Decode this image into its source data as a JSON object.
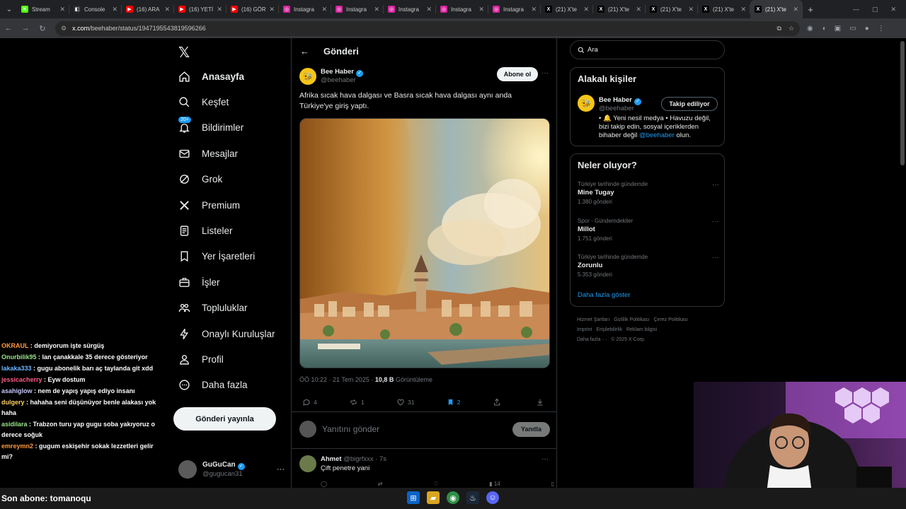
{
  "browser": {
    "tabs": [
      {
        "title": "Stream",
        "favicon": "k-icon",
        "color": "#53fc18"
      },
      {
        "title": "Console",
        "favicon": "kick-icon",
        "color": "#2d2d2d"
      },
      {
        "title": "(16) ARA",
        "favicon": "youtube-icon",
        "color": "#ff0000"
      },
      {
        "title": "(16) YETİ",
        "favicon": "youtube-icon",
        "color": "#ff0000"
      },
      {
        "title": "(16) GÖR",
        "favicon": "youtube-icon",
        "color": "#ff0000"
      },
      {
        "title": "Instagra",
        "favicon": "instagram-icon",
        "color": "#d6249f"
      },
      {
        "title": "Instagra",
        "favicon": "instagram-icon",
        "color": "#d6249f"
      },
      {
        "title": "Instagra",
        "favicon": "instagram-icon",
        "color": "#d6249f"
      },
      {
        "title": "Instagra",
        "favicon": "instagram-icon",
        "color": "#d6249f"
      },
      {
        "title": "Instagra",
        "favicon": "instagram-icon",
        "color": "#d6249f"
      },
      {
        "title": "(21) X'te",
        "favicon": "x-icon",
        "color": "#000000"
      },
      {
        "title": "(21) X'te",
        "favicon": "x-icon",
        "color": "#000000"
      },
      {
        "title": "(21) X'te",
        "favicon": "x-icon",
        "color": "#000000"
      },
      {
        "title": "(21) X'te",
        "favicon": "x-icon",
        "color": "#000000"
      },
      {
        "title": "(21) X'te",
        "favicon": "x-icon",
        "color": "#000000",
        "active": true
      }
    ],
    "url_site": "x.com",
    "url_path": "/beehaber/status/1947195543819596266"
  },
  "nav": {
    "items": [
      {
        "label": "Anasayfa",
        "icon": "home-icon"
      },
      {
        "label": "Keşfet",
        "icon": "search-icon"
      },
      {
        "label": "Bildirimler",
        "icon": "bell-icon",
        "badge": "20+"
      },
      {
        "label": "Mesajlar",
        "icon": "mail-icon"
      },
      {
        "label": "Grok",
        "icon": "grok-icon"
      },
      {
        "label": "Premium",
        "icon": "x-logo-icon"
      },
      {
        "label": "Listeler",
        "icon": "list-icon"
      },
      {
        "label": "Yer İşaretleri",
        "icon": "bookmark-icon"
      },
      {
        "label": "İşler",
        "icon": "briefcase-icon"
      },
      {
        "label": "Topluluklar",
        "icon": "people-icon"
      },
      {
        "label": "Onaylı Kuruluşlar",
        "icon": "lightning-icon"
      },
      {
        "label": "Profil",
        "icon": "person-icon"
      },
      {
        "label": "Daha fazla",
        "icon": "more-circle-icon"
      }
    ],
    "post_button": "Gönderi yayınla",
    "account": {
      "name": "GuGuCan",
      "handle": "@gugucan31"
    }
  },
  "main": {
    "header_title": "Gönderi",
    "post": {
      "author": "Bee Haber",
      "handle": "@beehaber",
      "subscribe_label": "Abone ol",
      "text": "Afrika sıcak hava dalgası ve Basra sıcak hava dalgası aynı anda Türkiye'ye giriş yaptı.",
      "time": "ÖÖ 10:22 · 21 Tem 2025 · ",
      "views": "10,8 B",
      "views_label": " Görüntüleme",
      "actions": {
        "replies": "4",
        "reposts": "1",
        "likes": "31",
        "bookmarks": "2"
      }
    },
    "reply": {
      "placeholder": "Yanıtını gönder",
      "button": "Yanıtla"
    },
    "comment": {
      "name": "Ahmet",
      "meta": "@bigrfxxx · 7s",
      "text": "Çift penetre yani",
      "views": "14"
    }
  },
  "side": {
    "search_placeholder": "Ara",
    "related_title": "Alakalı kişiler",
    "related": {
      "name": "Bee Haber",
      "handle": "@beehaber",
      "button": "Takip ediliyor",
      "bio_pre": "• 🔔 Yeni nesil medya • Havuzu değil, bizi takip edin, sosyal içeriklerden bihaber değil ",
      "bio_link": "@beehaber",
      "bio_post": " olun."
    },
    "trends_title": "Neler oluyor?",
    "trends": [
      {
        "context": "Türkiye tarihinde gündemde",
        "name": "Mine Tugay",
        "posts": "1.380 gönderi"
      },
      {
        "context": "Spor · Gündemdekiler",
        "name": "Millot",
        "posts": "1.751 gönderi"
      },
      {
        "context": "Türkiye tarihinde gündemde",
        "name": "Zorunlu",
        "posts": "5.353 gönderi"
      }
    ],
    "show_more": "Daha fazla göster",
    "footer": [
      "Hizmet Şartları",
      "Gizlilik Politikası",
      "Çerez Politikası",
      "Imprint",
      "Erişilebilirlik",
      "Reklam bilgisi",
      "Daha fazla ···",
      "© 2025 X Corp."
    ]
  },
  "chat": [
    {
      "user": "OKRAUL",
      "msg": "demiyorum işte sürgüş"
    },
    {
      "user": "Onurbilik95",
      "msg": "lan çanakkale 35 derece gösteriyor"
    },
    {
      "user": "lakaka333",
      "msg": "gugu abonelik barı aç taylanda git xdd"
    },
    {
      "user": "jessicacherry",
      "msg": "Eyw dostum"
    },
    {
      "user": "asahiglow",
      "msg": "nem de yapış yapış ediyo insanı"
    },
    {
      "user": "dulgery",
      "msg": "hahaha seni düşünüyor benle alakası yok haha"
    },
    {
      "user": "asidilara",
      "msg": "Trabzon turu yap gugu soba yakıyoruz o derece soğuk"
    },
    {
      "user": "emreymn2",
      "msg": "gugum eskişehir sokak lezzetleri gelir mi?"
    }
  ],
  "subscriber_banner": "Son abone: tomanoqu",
  "colors": {
    "accent": "#1d9bf0",
    "bg": "#000000",
    "border": "#2f3336",
    "muted": "#71767b"
  }
}
